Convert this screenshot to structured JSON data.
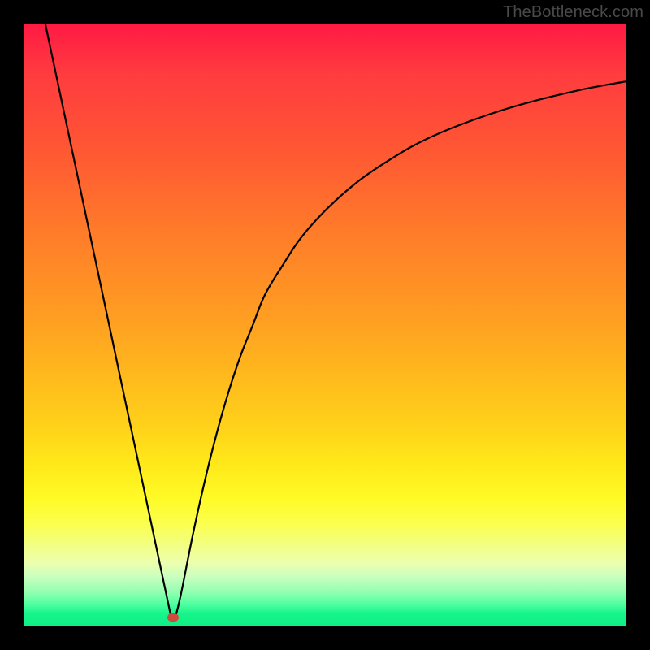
{
  "watermark": "TheBottleneck.com",
  "chart_data": {
    "type": "line",
    "title": "",
    "xlabel": "",
    "ylabel": "",
    "xlim": [
      0,
      100
    ],
    "ylim": [
      0,
      100
    ],
    "grid": false,
    "legend": false,
    "series": [
      {
        "name": "left-line",
        "x": [
          3.5,
          24.5
        ],
        "y": [
          100,
          1
        ]
      },
      {
        "name": "right-curve",
        "x": [
          25,
          26,
          28,
          30,
          32,
          34,
          36,
          38,
          40,
          43,
          46,
          50,
          55,
          60,
          66,
          73,
          82,
          92,
          100
        ],
        "y": [
          1,
          5,
          15,
          24,
          32,
          39,
          45,
          50,
          55,
          60,
          64.5,
          69,
          73.5,
          77,
          80.5,
          83.5,
          86.5,
          89,
          90.5
        ]
      }
    ],
    "marker": {
      "x": 24.7,
      "y": 1.3,
      "color": "#cf4b3f"
    }
  }
}
